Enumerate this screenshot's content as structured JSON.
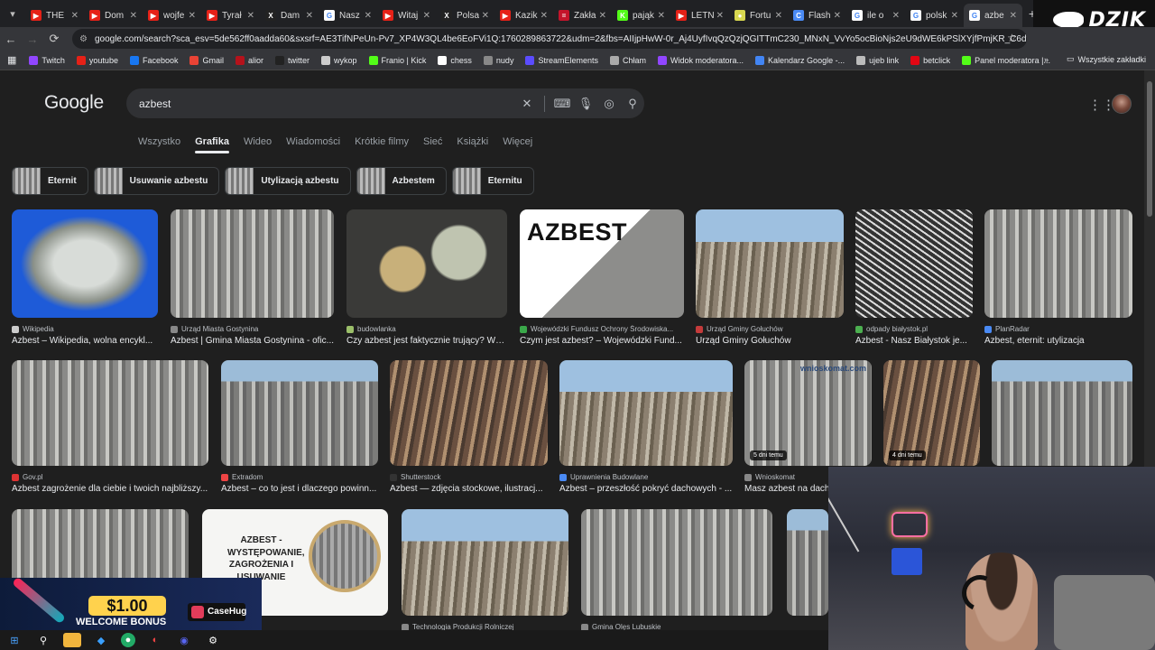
{
  "browser": {
    "tabs": [
      {
        "label": "THE",
        "color": "#e62117",
        "glyph": "▶"
      },
      {
        "label": "Dom",
        "color": "#e62117",
        "glyph": "▶"
      },
      {
        "label": "wojfe",
        "color": "#e62117",
        "glyph": "▶"
      },
      {
        "label": "Tyrał",
        "color": "#e62117",
        "glyph": "▶"
      },
      {
        "label": "Dam",
        "color": "#222222",
        "glyph": "X"
      },
      {
        "label": "Nasz",
        "color": "#ffffff",
        "glyph": "G"
      },
      {
        "label": "Witaj",
        "color": "#e62117",
        "glyph": "▶"
      },
      {
        "label": "Polsa",
        "color": "#222222",
        "glyph": "X"
      },
      {
        "label": "Kazik",
        "color": "#e62117",
        "glyph": "▶"
      },
      {
        "label": "Zakła",
        "color": "#c4142b",
        "glyph": "="
      },
      {
        "label": "pająk",
        "color": "#53fc18",
        "glyph": "K"
      },
      {
        "label": "LETN",
        "color": "#e62117",
        "glyph": "▶"
      },
      {
        "label": "Fortu",
        "color": "#d8d850",
        "glyph": "●"
      },
      {
        "label": "Flash",
        "color": "#4a8af4",
        "glyph": "C"
      },
      {
        "label": "ile o",
        "color": "#ffffff",
        "glyph": "G"
      },
      {
        "label": "polsk",
        "color": "#ffffff",
        "glyph": "G"
      },
      {
        "label": "azbe",
        "color": "#ffffff",
        "glyph": "G"
      }
    ],
    "new_tab": "+",
    "url": "google.com/search?sca_esv=5de562ff0aadda60&sxsrf=AE3TifNPeUn-Pv7_XP4W3QL4be6EoFVi1Q:1760289863722&udm=2&fbs=AIIjpHwW-0r_Aj4UyfIvqQzQzjQGITTmC230_MNxN_VvYo5ocBioNjs2eU9dWE6kPSlXYjfPmjKR_C6dtvDnjl0mGicejQr..."
  },
  "stream_logo": "DZIK",
  "bookmarks": [
    {
      "label": "Twitch",
      "color": "#9146ff"
    },
    {
      "label": "youtube",
      "color": "#e62117"
    },
    {
      "label": "Facebook",
      "color": "#1877f2"
    },
    {
      "label": "Gmail",
      "color": "#ea4335"
    },
    {
      "label": "alior",
      "color": "#b5121b"
    },
    {
      "label": "twitter",
      "color": "#222222"
    },
    {
      "label": "wykop",
      "color": "#cccccc"
    },
    {
      "label": "Franio | Kick",
      "color": "#53fc18"
    },
    {
      "label": "chess",
      "color": "#ffffff"
    },
    {
      "label": "nudy",
      "color": "#888888"
    },
    {
      "label": "StreamElements",
      "color": "#5b4cff"
    },
    {
      "label": "Chłam",
      "color": "#aaaaaa"
    },
    {
      "label": "Widok moderatora...",
      "color": "#9146ff"
    },
    {
      "label": "Kalendarz Google -...",
      "color": "#4285f4"
    },
    {
      "label": "ujeb link",
      "color": "#bbbbbb"
    },
    {
      "label": "betclick",
      "color": "#e30613"
    },
    {
      "label": "Panel moderatora |...",
      "color": "#53fc18"
    }
  ],
  "bookmarks_more": "»",
  "all_bookmarks": "Wszystkie zakładki",
  "google": {
    "logo": "Google",
    "query": "azbest",
    "tabs": [
      "Wszystko",
      "Grafika",
      "Wideo",
      "Wiadomości",
      "Krótkie filmy",
      "Sieć",
      "Książki",
      "Więcej"
    ],
    "active_tab": "Grafika",
    "chips": [
      "Eternit",
      "Usuwanie azbestu",
      "Utylizacją azbestu",
      "Azbestem",
      "Eternitu"
    ]
  },
  "results_row1": [
    {
      "source": "Wikipedia",
      "title": "Azbest – Wikipedia, wolna encykl...",
      "src_color": "#cccccc"
    },
    {
      "source": "Urząd Miasta Gostynina",
      "title": "Azbest | Gmina Miasta Gostynina - ofic...",
      "src_color": "#888888"
    },
    {
      "source": "budowlanka",
      "title": "Czy azbest jest faktycznie trujący? Ws...",
      "src_color": "#9bbf6a"
    },
    {
      "source": "Wojewódzki Fundusz Ochrony Środowiska...",
      "title": "Czym jest azbest? – Wojewódzki Fund...",
      "src_color": "#3aa84a",
      "overlay_text": "AZBEST"
    },
    {
      "source": "Urząd Gminy Gołuchów",
      "title": "Urząd Gminy Gołuchów",
      "src_color": "#c43b3b"
    },
    {
      "source": "odpady białystok.pl",
      "title": "Azbest - Nasz Białystok je...",
      "src_color": "#4caf50"
    },
    {
      "source": "PlanRadar",
      "title": "Azbest, eternit: utylizacja",
      "src_color": "#4a8af4"
    }
  ],
  "results_row2": [
    {
      "source": "Gov.pl",
      "title": "Azbest zagrożenie dla ciebie i twoich najbliższy...",
      "src_color": "#d33"
    },
    {
      "source": "Extradom",
      "title": "Azbest – co to jest i dlaczego powinn...",
      "src_color": "#e44"
    },
    {
      "source": "Shutterstock",
      "title": "Azbest — zdjęcia stockowe, ilustracj...",
      "src_color": "#333"
    },
    {
      "source": "Uprawnienia Budowlane",
      "title": "Azbest – przeszłość pokryć dachowych - ...",
      "src_color": "#4a8af4"
    },
    {
      "source": "Wnioskomat",
      "title": "Masz azbest na dach",
      "src_color": "#888",
      "badge": "5 dni temu",
      "overlay_text": "wnioskomat.com"
    },
    {
      "source": "",
      "title": "",
      "src_color": "#888",
      "badge": "4 dni temu"
    },
    {
      "source": "",
      "title": "",
      "src_color": "#888"
    }
  ],
  "results_row3": [
    {
      "source": "",
      "title": ""
    },
    {
      "source": "",
      "title": "",
      "poster_text": "AZBEST - WYSTĘPOWANIE, ZAGROŻENIA I USUWANIE"
    },
    {
      "source": "Technologia Produkcji Rolniczej",
      "title": ""
    },
    {
      "source": "Gmina Olęs Lubuskie",
      "title": ""
    },
    {
      "source": "",
      "title": ""
    }
  ],
  "promo": {
    "price": "$1.00",
    "text": "WELCOME BONUS",
    "brand": "CaseHug"
  }
}
